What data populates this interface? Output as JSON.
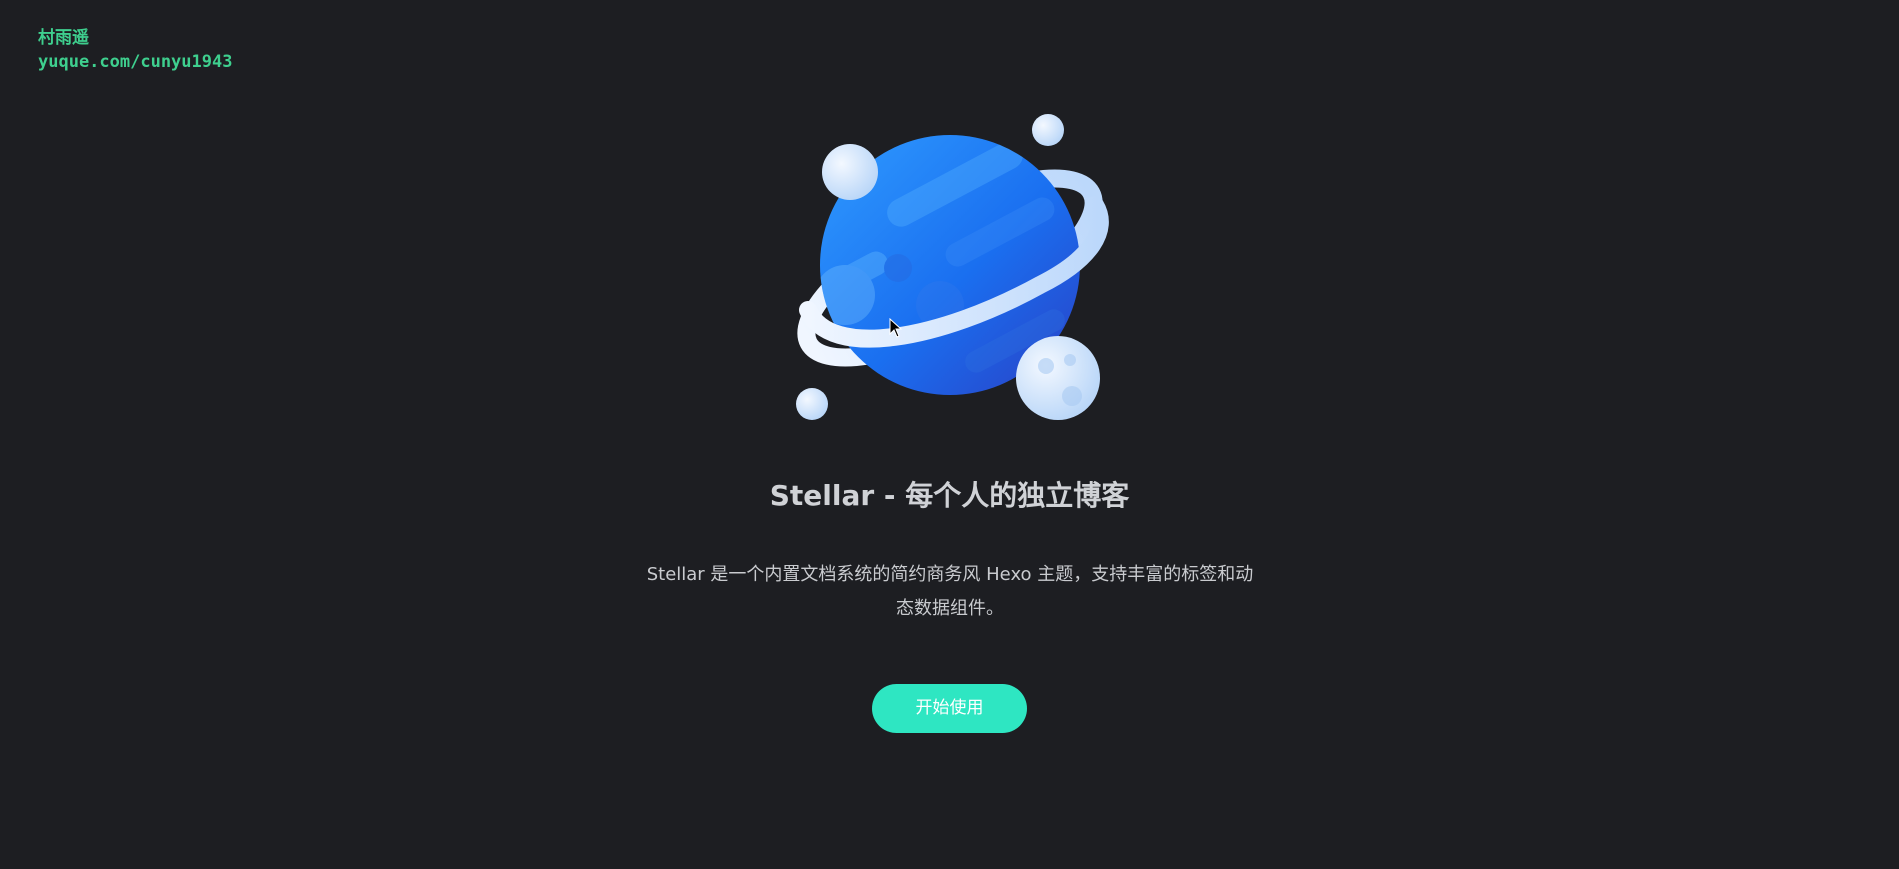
{
  "watermark": {
    "line1": "村雨遥",
    "line2": "yuque.com/cunyu1943"
  },
  "hero": {
    "title": "Stellar - 每个人的独立博客",
    "description": "Stellar 是一个内置文档系统的简约商务风 Hexo 主题，支持丰富的标签和动态数据组件。",
    "cta_label": "开始使用"
  },
  "colors": {
    "background": "#1d1e22",
    "watermark": "#3ecf8e",
    "cta": "#2ee6c2",
    "planet": "#1f7ef0",
    "ring": "#dbeafe"
  },
  "icons": {
    "illustration": "planet-illustration",
    "pointer": "mouse-cursor-icon"
  }
}
